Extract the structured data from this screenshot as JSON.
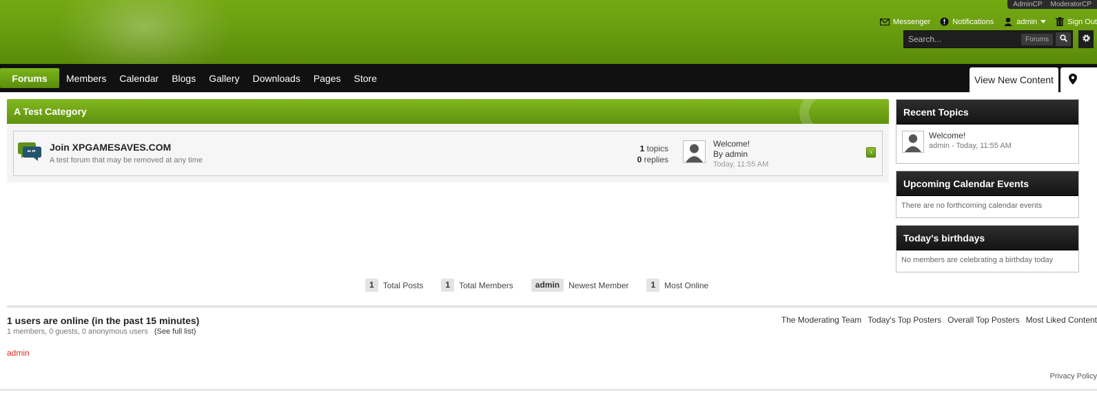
{
  "header": {
    "admin_strip": [
      "AdminCP",
      "ModeratorCP"
    ],
    "user_links": {
      "messenger": "Messenger",
      "notifications": "Notifications",
      "user": "admin",
      "sign_out": "Sign Out"
    },
    "search": {
      "placeholder": "Search...",
      "scope": "Forums"
    }
  },
  "nav": {
    "active_tab": "Forums",
    "items": [
      "Members",
      "Calendar",
      "Blogs",
      "Gallery",
      "Downloads",
      "Pages",
      "Store"
    ],
    "view_new_content": "View New Content"
  },
  "category": {
    "title": "A Test Category",
    "forum": {
      "title": "Join XPGAMESAVES.COM",
      "description": "A test forum that may be removed at any time",
      "topics_count": "1",
      "topics_label": "topics",
      "replies_count": "0",
      "replies_label": "replies",
      "last_post": {
        "title": "Welcome!",
        "by": "By admin",
        "time": "Today, 11:55 AM"
      }
    }
  },
  "sidebar": {
    "recent_topics": {
      "title": "Recent Topics",
      "item_title": "Welcome!",
      "item_meta": "admin - Today, 11:55 AM"
    },
    "calendar": {
      "title": "Upcoming Calendar Events",
      "body": "There are no forthcoming calendar events"
    },
    "birthdays": {
      "title": "Today's birthdays",
      "body": "No members are celebrating a birthday today"
    }
  },
  "stats": {
    "total_posts_count": "1",
    "total_posts_label": "Total Posts",
    "total_members_count": "1",
    "total_members_label": "Total Members",
    "newest_member_name": "admin",
    "newest_member_label": "Newest Member",
    "most_online_count": "1",
    "most_online_label": "Most Online"
  },
  "online": {
    "title": "1 users are online (in the past 15 minutes)",
    "summary": "1 members, 0 guests, 0 anonymous users",
    "full_list": "(See full list)",
    "user": "admin",
    "links": [
      "The Moderating Team",
      "Today's Top Posters",
      "Overall Top Posters",
      "Most Liked Content"
    ]
  },
  "footer": {
    "privacy": "Privacy Policy"
  },
  "colors": {
    "brand_green": "#6a9e10",
    "nav_black": "#111111",
    "online_user_red": "#e02a1f"
  }
}
